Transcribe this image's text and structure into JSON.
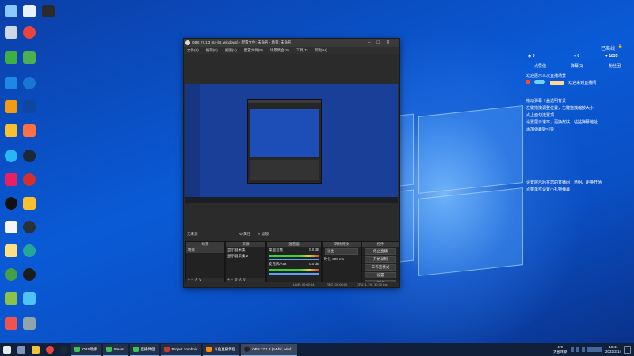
{
  "colors": {
    "accent": "#0a5ad6",
    "obs_bg": "#2b2b2b",
    "taskbar": "#10203a",
    "right_panel_alert": "#ff4a2a",
    "right_panel_link": "#ffdc8a"
  },
  "obs": {
    "title": "OBS 27.1.3 (64-bit, windows) - 配置文件: 未命名 - 场景: 未命名",
    "menu": [
      "文件(F)",
      "编辑(E)",
      "视图(V)",
      "配置文件(P)",
      "场景集合(S)",
      "工具(T)",
      "帮助(H)"
    ],
    "scene_label": "无来源",
    "scene_properties": "属性",
    "scene_filters": "滤镜",
    "docks": {
      "scenes": {
        "title": "场景",
        "items": [
          "场景"
        ]
      },
      "sources": {
        "title": "来源",
        "items": [
          "显示器采集",
          "显示器采集 2"
        ]
      },
      "mixer": {
        "title": "混音器",
        "tracks": [
          {
            "name": "桌面音频",
            "db": "0.0 dB"
          },
          {
            "name": "麦克风/Aux",
            "db": "0.0 dB"
          }
        ]
      },
      "transitions": {
        "title": "转场特效",
        "type": "淡出",
        "duration_label": "时长",
        "duration": "300 ms"
      },
      "controls": {
        "title": "控件",
        "buttons": [
          "停止直播",
          "开始录制",
          "工作室模式",
          "设置",
          "退出"
        ]
      }
    },
    "status": {
      "live": "LIVE: 00:00:04",
      "rec": "REC: 00:00:00",
      "cpu": "CPU: 1.1%, 30.00 fps"
    }
  },
  "right_panel": {
    "status": "已离线",
    "stats": [
      {
        "icon": "eye-icon",
        "value": "0"
      },
      {
        "icon": "user-icon",
        "value": "0"
      },
      {
        "icon": "heart-icon",
        "value": "1835"
      }
    ],
    "tabs": [
      "点赞值",
      "弹幕(1)",
      "粉丝团"
    ],
    "welcome": "欢迎展示本次直播场景",
    "line": "欢迎来到直播间",
    "tips_1": [
      "拖动弹幕卡盖透明背景",
      "左键拖拽调整位置，右键拖拽缩放大小",
      "点上面勾选置顶",
      "设置展示速率，更换皮肤，粘贴弹幕地址",
      "添加弹幕姬引导"
    ],
    "tips_2": [
      "设置展示后在您的直播间，透明，更换开场",
      "点菜单可设置小礼物弹幕"
    ]
  },
  "taskbar": {
    "tasks": [
      "OBS助手",
      "Steam",
      "直播伴侣",
      "Project Zomboid",
      "斗鱼直播伴侣",
      "OBS 27.1.3 (64-bit, wind..."
    ],
    "weather": "4°C",
    "weather_text": "大部晴朗",
    "time": "19:41",
    "date": "2022/2/14"
  }
}
